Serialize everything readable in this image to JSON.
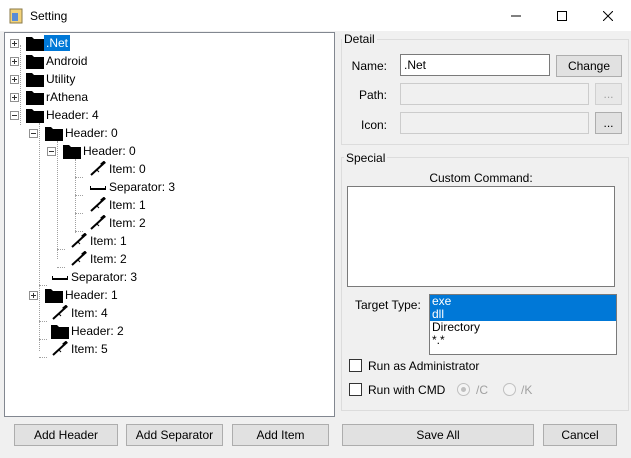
{
  "window": {
    "title": "Setting"
  },
  "tree": {
    "nodes": [
      {
        "label": ".Net",
        "selected": true,
        "type": "header",
        "expander": "plus"
      },
      {
        "label": "Android",
        "type": "header",
        "expander": "plus"
      },
      {
        "label": "Utility",
        "type": "header",
        "expander": "plus"
      },
      {
        "label": "rAthena",
        "type": "header",
        "expander": "plus"
      },
      {
        "label": "Header: 4",
        "type": "header",
        "expander": "minus"
      },
      {
        "label": "Header: 0",
        "type": "header",
        "expander": "minus"
      },
      {
        "label": "Header: 0",
        "type": "header",
        "expander": "minus"
      },
      {
        "label": "Item: 0",
        "type": "item"
      },
      {
        "label": "Separator: 3",
        "type": "separator"
      },
      {
        "label": "Item: 1",
        "type": "item"
      },
      {
        "label": "Item: 2",
        "type": "item"
      },
      {
        "label": "Item: 1",
        "type": "item"
      },
      {
        "label": "Item: 2",
        "type": "item"
      },
      {
        "label": "Separator: 3",
        "type": "separator"
      },
      {
        "label": "Header: 1",
        "type": "header",
        "expander": "plus"
      },
      {
        "label": "Item: 4",
        "type": "item"
      },
      {
        "label": "Header: 2",
        "type": "header"
      },
      {
        "label": "Item: 5",
        "type": "item"
      }
    ]
  },
  "detail": {
    "group_title": "Detail",
    "name_label": "Name:",
    "name_value": ".Net",
    "change_button": "Change",
    "path_label": "Path:",
    "path_value": "",
    "path_browse": "...",
    "icon_label": "Icon:",
    "icon_value": "",
    "icon_browse": "..."
  },
  "special": {
    "group_title": "Special",
    "custom_command_label": "Custom Command:",
    "custom_command_value": "",
    "target_type_label": "Target Type:",
    "target_types": [
      {
        "label": "exe",
        "selected": true
      },
      {
        "label": "dll",
        "selected": true
      },
      {
        "label": "Directory",
        "selected": false
      },
      {
        "label": "*.*",
        "selected": false
      }
    ],
    "run_as_admin_label": "Run as Administrator",
    "run_as_admin_checked": false,
    "run_with_cmd_label": "Run with CMD",
    "run_with_cmd_checked": false,
    "radio_c_label": "/C",
    "radio_k_label": "/K",
    "radio_selected": "/C"
  },
  "buttons": {
    "add_header": "Add Header",
    "add_separator": "Add Separator",
    "add_item": "Add Item",
    "save_all": "Save All",
    "cancel": "Cancel"
  },
  "colors": {
    "selection": "#0078d7",
    "window": "#f0f0f0",
    "field": "#ffffff"
  }
}
